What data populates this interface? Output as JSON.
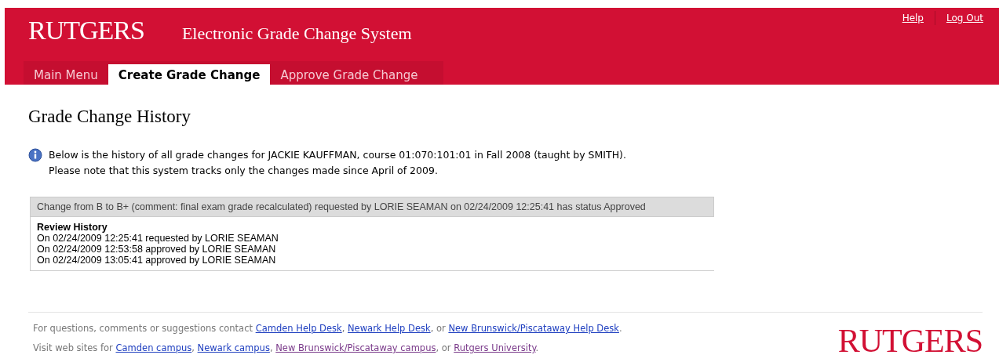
{
  "header": {
    "logo": "RUTGERS",
    "title": "Electronic Grade Change System",
    "links": [
      "Help",
      "Log Out"
    ]
  },
  "tabs": [
    {
      "label": "Main Menu",
      "selected": false
    },
    {
      "label": "Create Grade Change",
      "selected": true
    },
    {
      "label": "Approve Grade Change",
      "selected": false
    }
  ],
  "page_title": "Grade Change History",
  "info": [
    "Below is the history of all grade changes for JACKIE KAUFFMAN, course 01:070:101:01 in Fall 2008 (taught by SMITH).",
    "Please note that this system tracks only the changes made since April of 2009."
  ],
  "changes": [
    {
      "summary": "Change from B to B+ (comment: final exam grade recalculated) requested by LORIE SEAMAN on 02/24/2009 12:25:41 has status Approved",
      "history_title": "Review History",
      "history": [
        "On 02/24/2009 12:25:41 requested by LORIE SEAMAN",
        "On 02/24/2009 12:53:58 approved by LORIE SEAMAN",
        "On 02/24/2009 13:05:41 approved by LORIE SEAMAN"
      ]
    }
  ],
  "footer": {
    "lines": [
      [
        {
          "text": "For questions, comments or suggestions contact "
        },
        {
          "link": "Camden Help Desk",
          "visited": false
        },
        {
          "text": ", "
        },
        {
          "link": "Newark Help Desk",
          "visited": false
        },
        {
          "text": ", or "
        },
        {
          "link": "New Brunswick/Piscataway Help Desk",
          "visited": false
        },
        {
          "text": "."
        }
      ],
      [
        {
          "text": "Visit web sites for "
        },
        {
          "link": "Camden campus",
          "visited": false
        },
        {
          "text": ", "
        },
        {
          "link": "Newark campus",
          "visited": false
        },
        {
          "text": ", "
        },
        {
          "link": "New Brunswick/Piscataway campus",
          "visited": true
        },
        {
          "text": ", or "
        },
        {
          "link": "Rutgers University",
          "visited": true
        },
        {
          "text": "."
        }
      ]
    ],
    "logo": "RUTGERS"
  }
}
